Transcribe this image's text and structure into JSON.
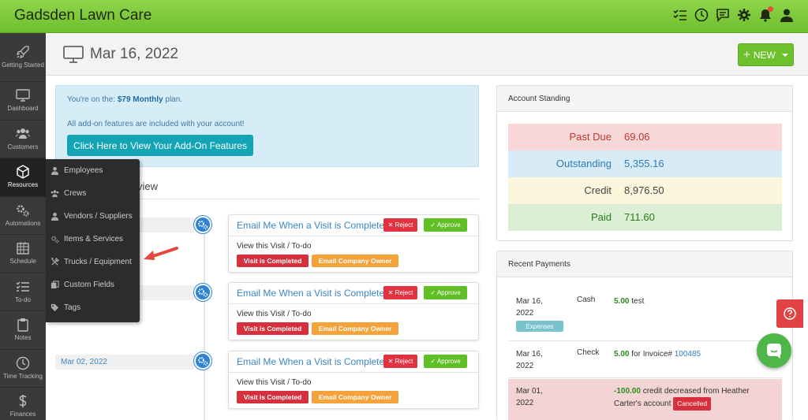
{
  "app": {
    "title": "Gadsden Lawn Care"
  },
  "topbar": {
    "icons": [
      "checklist-icon",
      "clock-icon",
      "chat-icon",
      "gear-icon",
      "bell-icon",
      "user-icon"
    ]
  },
  "sidebar": {
    "items": [
      {
        "label": "Getting Started",
        "icon": "rocket-icon"
      },
      {
        "label": "Dashboard",
        "icon": "monitor-icon"
      },
      {
        "label": "Customers",
        "icon": "users-icon"
      },
      {
        "label": "Resources",
        "icon": "cube-icon"
      },
      {
        "label": "Automations",
        "icon": "gears-icon"
      },
      {
        "label": "Schedule",
        "icon": "calendar-icon"
      },
      {
        "label": "To-do",
        "icon": "list-icon"
      },
      {
        "label": "Notes",
        "icon": "clipboard-icon"
      },
      {
        "label": "Time Tracking",
        "icon": "clock-icon"
      },
      {
        "label": "Finances",
        "icon": "dollar-icon"
      }
    ]
  },
  "header": {
    "title": "Mar 16, 2022",
    "new_label": "NEW"
  },
  "plan": {
    "prefix": "You're on the: ",
    "plan_name": "$79 Monthly",
    "suffix": " plan.",
    "addons_note": "All add-on features are included with your account!",
    "button": "Click Here to View Your Add-On Features"
  },
  "overview": {
    "title_fragment": "view"
  },
  "dropdown": {
    "items": [
      {
        "label": "Employees",
        "icon": "user-icon"
      },
      {
        "label": "Crews",
        "icon": "users-icon"
      },
      {
        "label": "Vendors / Suppliers",
        "icon": "user-icon"
      },
      {
        "label": "Items & Services",
        "icon": "gears-icon"
      },
      {
        "label": "Trucks / Equipment",
        "icon": "tools-icon"
      },
      {
        "label": "Custom Fields",
        "icon": "copy-icon"
      },
      {
        "label": "Tags",
        "icon": "tags-icon"
      }
    ]
  },
  "timeline": [
    {
      "date": "",
      "title": "Email Me When a Visit is Complete",
      "reject": "✕ Reject",
      "approve": "✓ Approve",
      "view": "View this Visit / To-do",
      "badge1": "Visit is Completed",
      "badge2": "Email Company Owner"
    },
    {
      "date": "",
      "title": "Email Me When a Visit is Complete",
      "reject": "✕ Reject",
      "approve": "✓ Approve",
      "view": "View this Visit / To-do",
      "badge1": "Visit is Completed",
      "badge2": "Email Company Owner"
    },
    {
      "date": "Mar 02, 2022",
      "title": "Email Me When a Visit is Complete",
      "reject": "✕ Reject",
      "approve": "✓ Approve",
      "view": "View this Visit / To-do",
      "badge1": "Visit is Completed",
      "badge2": "Email Company Owner"
    }
  ],
  "account_standing": {
    "title": "Account Standing",
    "rows": [
      {
        "label": "Past Due",
        "value": "69.06",
        "bg": "#f7d7d8",
        "label_color": "#c0392b",
        "value_color": "#c0392b"
      },
      {
        "label": "Outstanding",
        "value": "5,355.16",
        "bg": "#d7ecf6",
        "label_color": "#2e7cb6",
        "value_color": "#2e7cb6"
      },
      {
        "label": "Credit",
        "value": "8,976.50",
        "bg": "#fbf6dc",
        "label_color": "#444",
        "value_color": "#444"
      },
      {
        "label": "Paid",
        "value": "711.60",
        "bg": "#dbefd5",
        "label_color": "#2a7a1b",
        "value_color": "#2a7a1b"
      }
    ]
  },
  "recent_payments": {
    "title": "Recent Payments",
    "rows": [
      {
        "date": "Mar 16, 2022",
        "type": "Cash",
        "amount": "5.00",
        "desc": "test",
        "tag": "Expenses"
      },
      {
        "date": "Mar 16, 2022",
        "type": "Check",
        "amount": "5.00",
        "desc": "for Invoice#",
        "link": "100485"
      },
      {
        "date": "Mar 01, 2022",
        "type": "",
        "amount": "-100.00",
        "desc": "credit decreased from Heather Carter's account",
        "tag": "Cancelled"
      }
    ]
  },
  "colors": {
    "brand_green": "#7cc83a",
    "accent_blue": "#2d82d6"
  }
}
